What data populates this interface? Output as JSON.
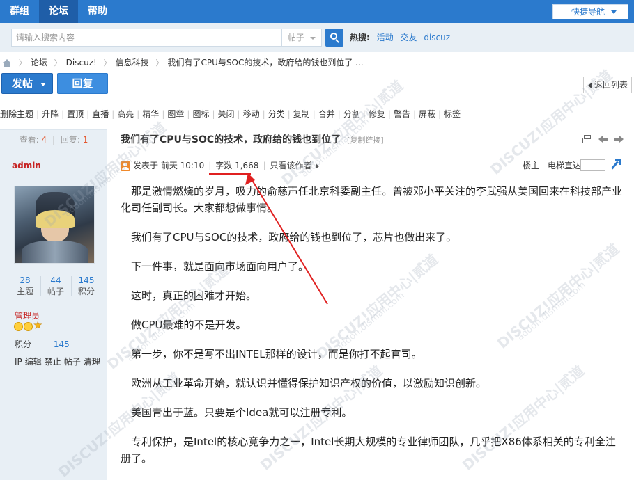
{
  "nav": {
    "items": [
      {
        "label": "群组"
      },
      {
        "label": "论坛",
        "active": true
      },
      {
        "label": "帮助"
      }
    ],
    "quick_nav": "快捷导航"
  },
  "search": {
    "placeholder": "请输入搜索内容",
    "type": "帖子",
    "hot_label": "热搜:",
    "hot_terms": [
      "活动",
      "交友",
      "discuz"
    ]
  },
  "breadcrumb": [
    "论坛",
    "Discuz!",
    "信息科技",
    "我们有了CPU与SOC的技术，政府给的钱也到位了 ..."
  ],
  "actions": {
    "post": "发帖",
    "reply": "回复",
    "back": "返回列表"
  },
  "mod_tools": [
    "删除主题",
    "升降",
    "置顶",
    "直播",
    "高亮",
    "精华",
    "图章",
    "图标",
    "关闭",
    "移动",
    "分类",
    "复制",
    "合并",
    "分割",
    "修复",
    "警告",
    "屏蔽",
    "标签"
  ],
  "thread": {
    "views_label": "查看:",
    "views": "4",
    "replies_label": "回复:",
    "replies": "1",
    "title": "我们有了CPU与SOC的技术，政府给的钱也到位了",
    "copy_link": "[复制链接]"
  },
  "author": {
    "name": "admin",
    "stats": [
      {
        "value": "28",
        "label": "主题"
      },
      {
        "value": "44",
        "label": "帖子"
      },
      {
        "value": "145",
        "label": "积分"
      }
    ],
    "role": "管理员",
    "points_label": "积分",
    "points": "145",
    "admin_links": [
      "IP",
      "编辑",
      "禁止",
      "帖子",
      "清理"
    ]
  },
  "post": {
    "posted": "发表于 前天 10:10",
    "word_count": "字数 1,668",
    "author_only": "只看该作者",
    "floor": "楼主",
    "elevator": "电梯直达",
    "paragraphs": [
      "那是激情燃烧的岁月，吸力的俞慈声任北京科委副主任。曾被邓小平关注的李武强从美国回来在科技部产业化司任副司长。大家都想做事情。",
      "我们有了CPU与SOC的技术，政府给的钱也到位了，芯片也做出来了。",
      "下一件事，就是面向市场面向用户了。",
      "这时，真正的困难才开始。",
      "做CPU最难的不是开发。",
      "第一步，你不是写不出INTEL那样的设计，而是你打不起官司。",
      "欧洲从工业革命开始，就认识并懂得保护知识产权的价值，以激励知识创新。",
      "美国青出于蓝。只要是个Idea就可以注册专利。",
      "专利保护，是Intel的核心竞争力之一，Intel长期大规模的专业律师团队，几乎把X86体系相关的专利全注册了。"
    ]
  },
  "watermark": {
    "brand": "DISCUZ!应用中心|贰道",
    "domain": "addon.dismall.com"
  },
  "colors": {
    "brand_blue": "#2b7acd",
    "highlight_red": "#e02020",
    "admin_red": "#c62424"
  }
}
